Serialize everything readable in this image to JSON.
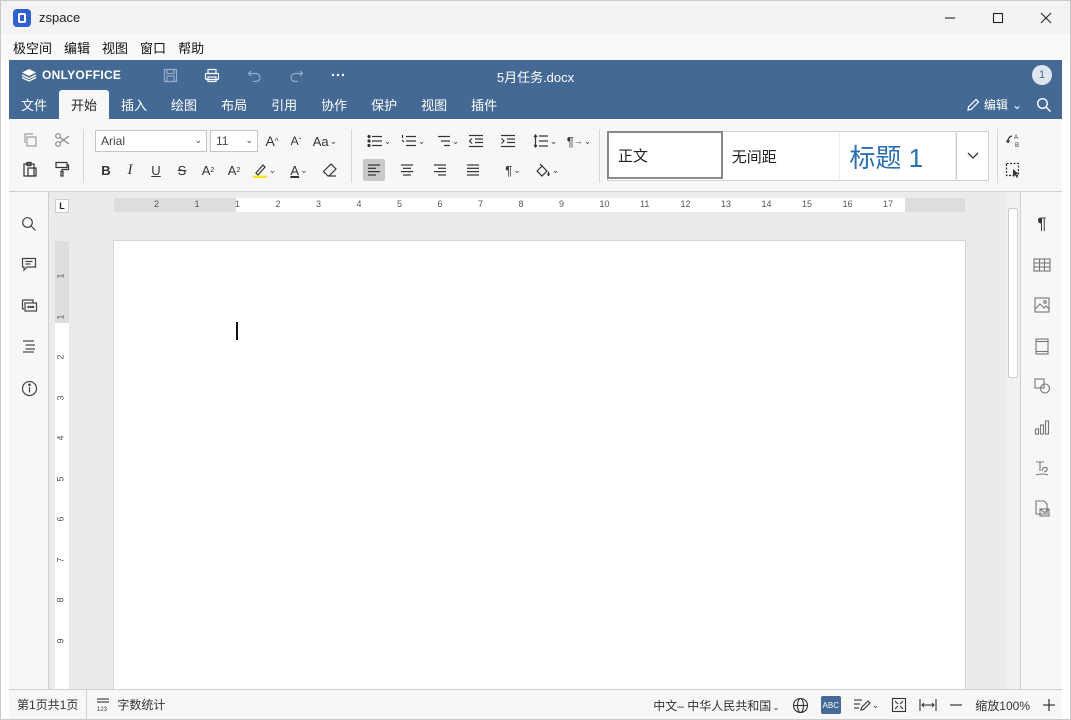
{
  "window": {
    "app_title": "zspace",
    "menu": [
      "极空间",
      "编辑",
      "视图",
      "窗口",
      "帮助"
    ]
  },
  "editor": {
    "brand": "ONLYOFFICE",
    "document_title": "5月任务.docx",
    "user_count": "1",
    "tabs": [
      {
        "label": "文件",
        "active": false
      },
      {
        "label": "开始",
        "active": true
      },
      {
        "label": "插入",
        "active": false
      },
      {
        "label": "绘图",
        "active": false
      },
      {
        "label": "布局",
        "active": false
      },
      {
        "label": "引用",
        "active": false
      },
      {
        "label": "协作",
        "active": false
      },
      {
        "label": "保护",
        "active": false
      },
      {
        "label": "视图",
        "active": false
      },
      {
        "label": "插件",
        "active": false
      }
    ],
    "mode_label": "编辑"
  },
  "toolbar": {
    "font_name": "Arial",
    "font_size": "11",
    "grow_font": "A",
    "shrink_font": "A",
    "change_case": "Aa",
    "bold": "B",
    "italic": "I",
    "underline": "U",
    "strike": "S",
    "superscript": "A",
    "subscript": "A",
    "font_color": "A",
    "paragraph_mark": "¶",
    "styles": [
      "正文",
      "无间距",
      "标题 1"
    ],
    "accent_color": "#446995",
    "heading_color": "#2a6fb0"
  },
  "ruler": {
    "h_numbers": [
      "2",
      "1",
      "1",
      "2",
      "3",
      "4",
      "5",
      "6",
      "7",
      "8",
      "9",
      "10",
      "11",
      "12",
      "13",
      "14",
      "15",
      "16",
      "17"
    ],
    "v_numbers": [
      "1",
      "1",
      "2",
      "3",
      "4",
      "5",
      "6",
      "7",
      "8",
      "9"
    ]
  },
  "statusbar": {
    "page_info": "第1页共1页",
    "word_count": "字数统计",
    "language": "中文– 中华人民共和国",
    "spell_label": "ABC",
    "zoom": "缩放100%"
  }
}
